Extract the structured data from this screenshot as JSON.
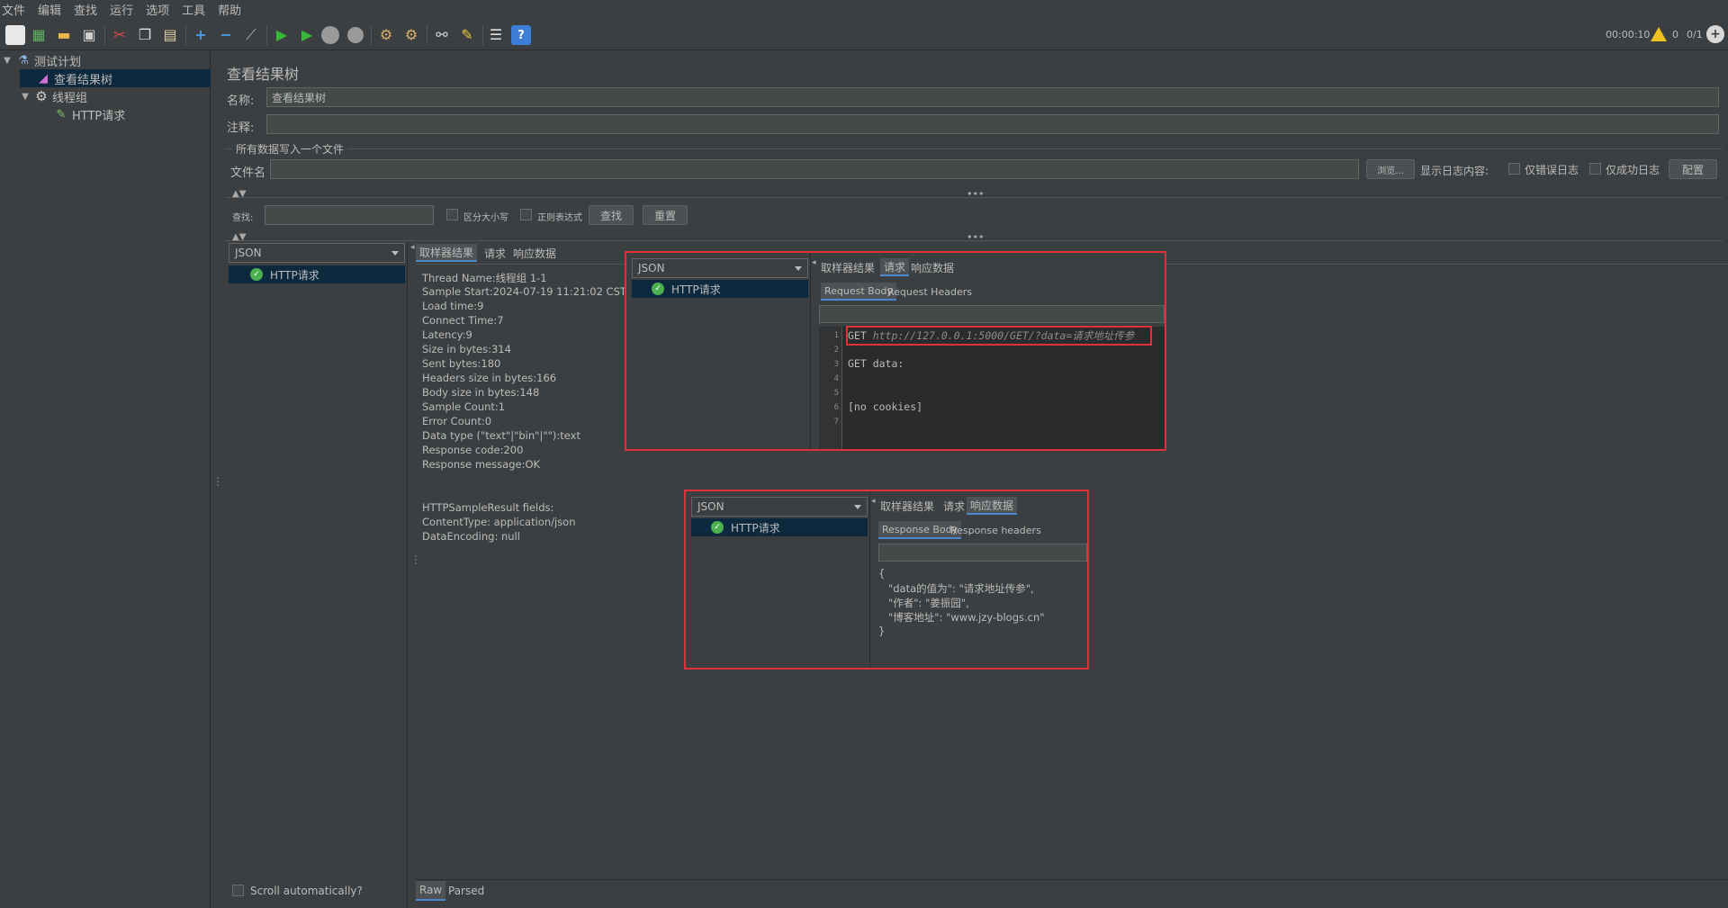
{
  "menu": [
    "文件",
    "编辑",
    "查找",
    "运行",
    "选项",
    "工具",
    "帮助"
  ],
  "toolbar_status": {
    "timer": "00:00:10",
    "warnings": "0",
    "threads": "0/1"
  },
  "tree": {
    "items": [
      {
        "label": "测试计划"
      },
      {
        "label": "查看结果树"
      },
      {
        "label": "线程组"
      },
      {
        "label": "HTTP请求"
      }
    ]
  },
  "panel": {
    "title": "查看结果树",
    "name_label": "名称:",
    "name_value": "查看结果树",
    "comment_label": "注释:",
    "comment_value": "",
    "file_section": "所有数据写入一个文件",
    "filename_label": "文件名",
    "filename_value": "",
    "browse_button": "浏览...",
    "log_label": "显示日志内容:",
    "errors_only": "仅错误日志",
    "success_only": "仅成功日志",
    "config_button": "配置"
  },
  "search": {
    "label": "查找:",
    "value": "",
    "case_sensitive": "区分大小写",
    "regex": "正则表达式",
    "find_button": "查找",
    "reset_button": "重置"
  },
  "results": {
    "renderer": "JSON",
    "sample": "HTTP请求",
    "tabs": [
      "取样器结果",
      "请求",
      "响应数据"
    ],
    "sampler_info": [
      "Thread Name:线程组 1-1",
      "Sample Start:2024-07-19 11:21:02 CST",
      "Load time:9",
      "Connect Time:7",
      "Latency:9",
      "Size in bytes:314",
      "Sent bytes:180",
      "Headers size in bytes:166",
      "Body size in bytes:148",
      "Sample Count:1",
      "Error Count:0",
      "Data type (\"text\"|\"bin\"|\"\"):text",
      "Response code:200",
      "Response message:OK"
    ],
    "fields_info": [
      "HTTPSampleResult fields:",
      "ContentType: application/json",
      "DataEncoding: null"
    ],
    "scroll_auto": "Scroll automatically?",
    "bottom_tabs": [
      "Raw",
      "Parsed"
    ]
  },
  "request_inset": {
    "renderer": "JSON",
    "sample": "HTTP请求",
    "tabs": [
      "取样器结果",
      "请求",
      "响应数据"
    ],
    "subtabs": [
      "Request Body",
      "Request Headers"
    ],
    "line_numbers": [
      "1",
      "2",
      "3",
      "4",
      "5",
      "6",
      "7"
    ],
    "line1_method": "GET ",
    "line1_url": "http://127.0.0.1:5000/GET/?data=请求地址传参",
    "line3": "GET data:",
    "line6": "[no cookies]"
  },
  "response_inset": {
    "renderer": "JSON",
    "sample": "HTTP请求",
    "tabs": [
      "取样器结果",
      "请求",
      "响应数据"
    ],
    "subtabs": [
      "Response Body",
      "Response headers"
    ],
    "json_lines": [
      "{",
      "   \"data的值为\": \"请求地址传参\",",
      "   \"作者\": \"姜振园\",",
      "   \"博客地址\": \"www.jzy-blogs.cn\"",
      "}"
    ]
  },
  "colors": {
    "background": "#3c3f41",
    "selection": "#0d293e",
    "highlight_box": "#e0313b",
    "tab_underline": "#4a88c7"
  }
}
